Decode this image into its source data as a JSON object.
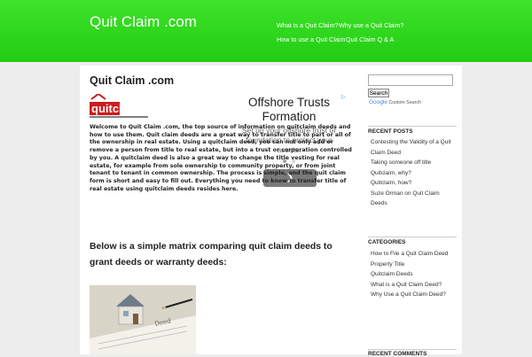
{
  "header": {
    "site_title": "Quit Claim .com",
    "nav": [
      {
        "label": "What is a Quit Claim?"
      },
      {
        "label": "Why use a Quit Claim?"
      },
      {
        "label": "How to use a Quit Claim"
      },
      {
        "label": "Quit Claim Q & A"
      }
    ]
  },
  "main": {
    "page_title": "Quit Claim .com",
    "logo_text": "quitclaim",
    "intro": "Welcome to Quit Claim .com, the top source of information on quitclaim deeds and how to use them. Quit claim deeds are a great way to transfer title to part or all of the ownership in real estate. Using a quitclaim deed, you can not only add or remove a person from title to real estate, but into a trust or corporation controlled by you.  A quitclaim deed is also a great way to change the title vesting for real estate, for example from sole ownership to community property, or from joint tenant to tenant in common ownership. The process is simple, and the quit claim form is short and easy to fill out. Everything you need to know to transfer title of real estate using quitclaim deeds resides here.",
    "subheading": "Below is a simple matrix comparing quit claim deeds to grant deeds or warranty deeds:",
    "image_caption": "Deed"
  },
  "ad": {
    "title": "Offshore Trusts Formation",
    "text": "Set up your offshore trust or foundation to protect your assets.",
    "close_icon": "ad-choices-icon",
    "arrow_icon": "chevron-right-icon",
    "colors": {
      "button": "#7a7a7a",
      "dot_active": "#9e9e9e",
      "dot_inactive": "#d6d6d6"
    }
  },
  "sidebar": {
    "search": {
      "placeholder": "",
      "button_label": "Search",
      "powered_by": "Google",
      "cse_label": "Custom Search"
    },
    "recent_posts": {
      "title": "RECENT POSTS",
      "items": [
        {
          "label": "Contesting the Validity of a Quit Claim Deed"
        },
        {
          "label": "Taking someone off title"
        },
        {
          "label": "Quitclaim, why?"
        },
        {
          "label": "Quitclaim, how?"
        },
        {
          "label": "Suze Orman on Quit Claim Deeds"
        }
      ]
    },
    "categories": {
      "title": "CATEGORIES",
      "items": [
        {
          "label": "How to File a Quit Claim Deed"
        },
        {
          "label": "Property Title"
        },
        {
          "label": "Quitclaim Deeds"
        },
        {
          "label": "What is a Quit Claim Deed?"
        },
        {
          "label": "Why Use a Quit Claim Deed?"
        }
      ]
    },
    "recent_comments": {
      "title": "RECENT COMMENTS"
    }
  },
  "colors": {
    "header_top": "#3ee32a",
    "header_bottom": "#22cc12",
    "background": "#ededed",
    "content": "#ffffff",
    "logo_red": "#cc1b1b"
  }
}
